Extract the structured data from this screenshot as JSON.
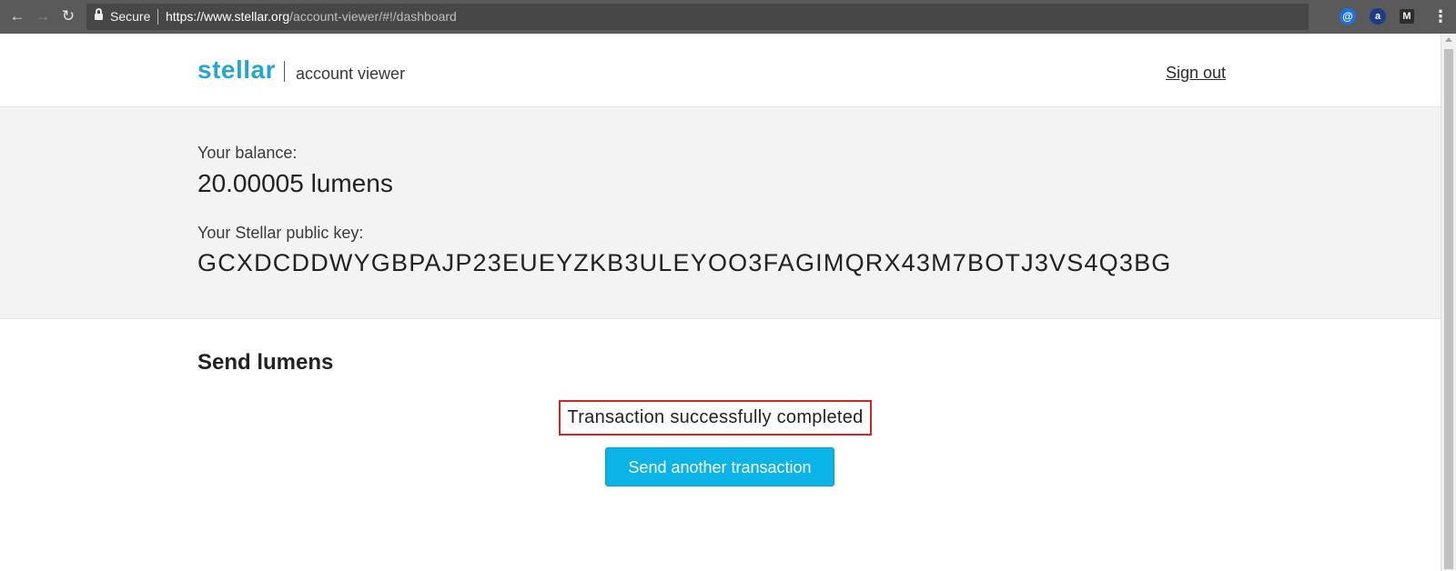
{
  "browser": {
    "nav": {
      "back_icon": "←",
      "forward_icon": "→",
      "reload_icon": "↻"
    },
    "omnibox": {
      "secure_label": "Secure",
      "url_host": "https://www.stellar.org",
      "url_path": "/account-viewer/#!/dashboard"
    },
    "star_icon": "☆",
    "extensions": [
      "@",
      "a",
      "M"
    ],
    "menu_icon": "⋮"
  },
  "header": {
    "logo": "stellar",
    "subtitle": "account viewer",
    "sign_out": "Sign out"
  },
  "account": {
    "balance_label": "Your balance:",
    "balance_value": "20.00005 lumens",
    "public_key_label": "Your Stellar public key:",
    "public_key_value": "GCXDCDDWYGBPAJP23EUEYZKB3ULEYOO3FAGIMQRX43M7BOTJ3VS4Q3BG"
  },
  "send": {
    "title": "Send lumens",
    "status_message": "Transaction successfully completed",
    "send_another_label": "Send another transaction"
  },
  "colors": {
    "brand": "#27a5d1",
    "button": "#0ab4e6",
    "success_border": "#d42323",
    "panel_bg": "#f3f3f3"
  }
}
